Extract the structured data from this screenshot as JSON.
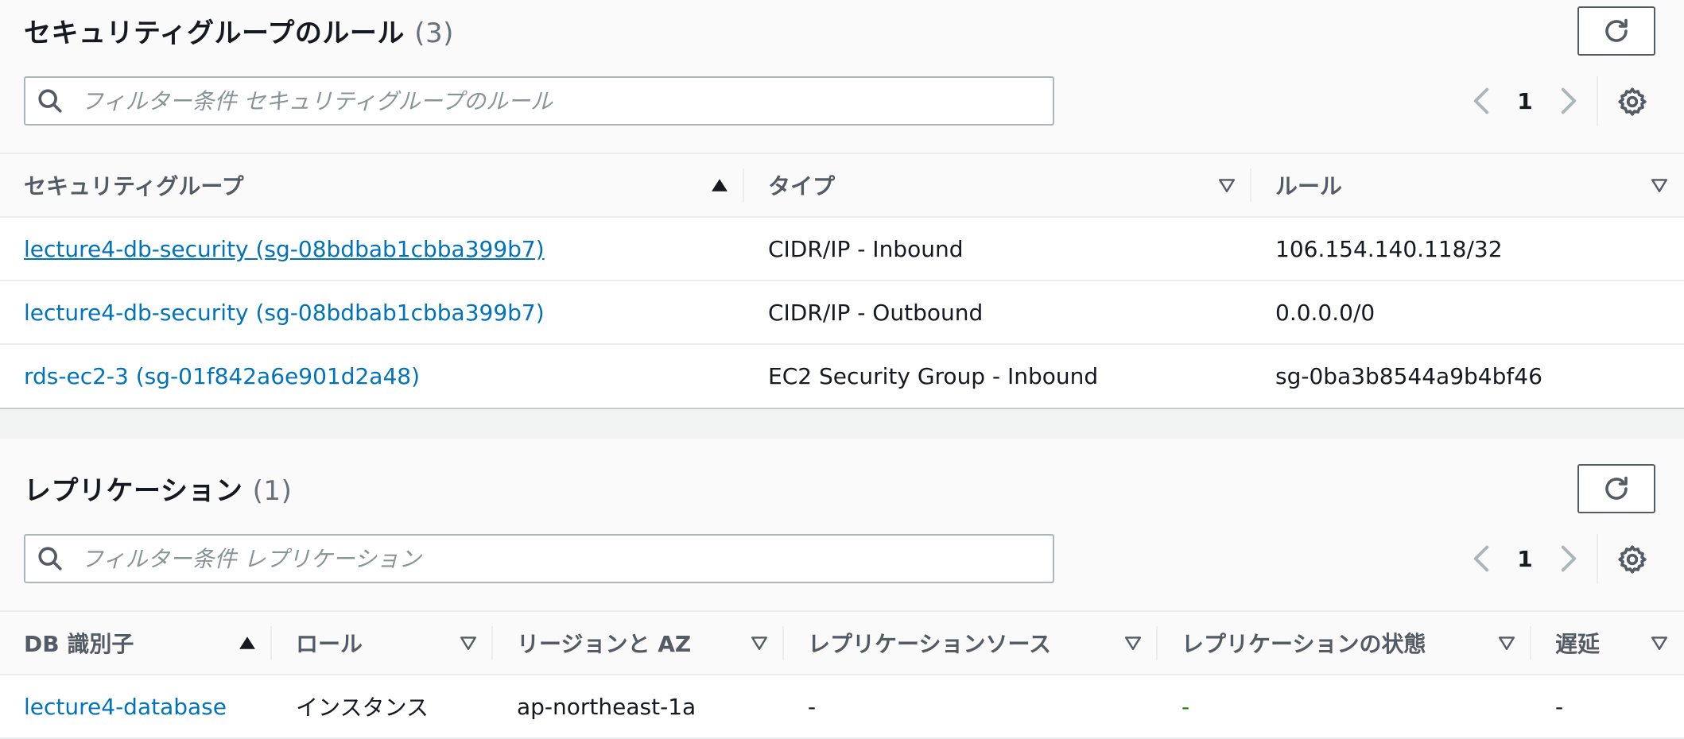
{
  "sg_panel": {
    "title": "セキュリティグループのルール",
    "count": "(3)",
    "search_placeholder": "フィルター条件 セキュリティグループのルール",
    "page": "1",
    "columns": [
      "セキュリティグループ",
      "タイプ",
      "ルール"
    ],
    "rows": [
      {
        "group": "lecture4-db-security (sg-08bdbab1cbba399b7)",
        "type": "CIDR/IP - Inbound",
        "rule": "106.154.140.118/32"
      },
      {
        "group": "lecture4-db-security (sg-08bdbab1cbba399b7)",
        "type": "CIDR/IP - Outbound",
        "rule": "0.0.0.0/0"
      },
      {
        "group": "rds-ec2-3 (sg-01f842a6e901d2a48)",
        "type": "EC2 Security Group - Inbound",
        "rule": "sg-0ba3b8544a9b4bf46"
      }
    ]
  },
  "rep_panel": {
    "title": "レプリケーション",
    "count": "(1)",
    "search_placeholder": "フィルター条件 レプリケーション",
    "page": "1",
    "columns": [
      "DB 識別子",
      "ロール",
      "リージョンと AZ",
      "レプリケーションソース",
      "レプリケーションの状態",
      "遅延"
    ],
    "rows": [
      {
        "db_id": "lecture4-database",
        "role": "インスタンス",
        "region_az": "ap-northeast-1a",
        "source": "-",
        "state": "-",
        "lag": "-"
      }
    ]
  },
  "icons": {
    "refresh": "refresh-icon",
    "search": "search-icon",
    "prev": "chevron-left-icon",
    "next": "chevron-right-icon",
    "settings": "gear-icon",
    "sort_asc": "sort-ascending-icon",
    "sort_none": "sort-descending-outline-icon"
  },
  "colors": {
    "link": "#0073bb",
    "text": "#16191f",
    "header_text": "#545b64",
    "muted": "#687078",
    "state_dash": "#1d8102"
  }
}
